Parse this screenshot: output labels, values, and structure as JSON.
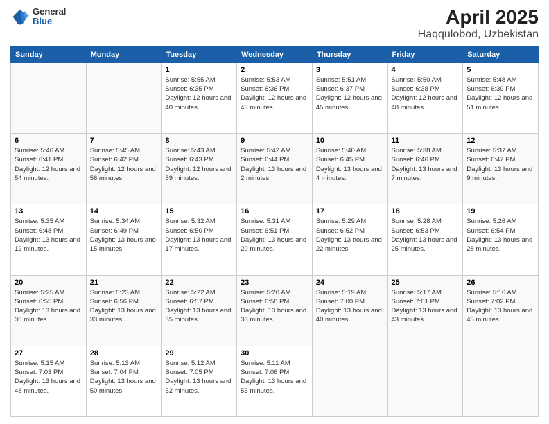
{
  "logo": {
    "general": "General",
    "blue": "Blue"
  },
  "title": "April 2025",
  "subtitle": "Haqqulobod, Uzbekistan",
  "days_of_week": [
    "Sunday",
    "Monday",
    "Tuesday",
    "Wednesday",
    "Thursday",
    "Friday",
    "Saturday"
  ],
  "weeks": [
    [
      {
        "day": "",
        "info": ""
      },
      {
        "day": "",
        "info": ""
      },
      {
        "day": "1",
        "info": "Sunrise: 5:55 AM\nSunset: 6:35 PM\nDaylight: 12 hours\nand 40 minutes."
      },
      {
        "day": "2",
        "info": "Sunrise: 5:53 AM\nSunset: 6:36 PM\nDaylight: 12 hours\nand 43 minutes."
      },
      {
        "day": "3",
        "info": "Sunrise: 5:51 AM\nSunset: 6:37 PM\nDaylight: 12 hours\nand 45 minutes."
      },
      {
        "day": "4",
        "info": "Sunrise: 5:50 AM\nSunset: 6:38 PM\nDaylight: 12 hours\nand 48 minutes."
      },
      {
        "day": "5",
        "info": "Sunrise: 5:48 AM\nSunset: 6:39 PM\nDaylight: 12 hours\nand 51 minutes."
      }
    ],
    [
      {
        "day": "6",
        "info": "Sunrise: 5:46 AM\nSunset: 6:41 PM\nDaylight: 12 hours\nand 54 minutes."
      },
      {
        "day": "7",
        "info": "Sunrise: 5:45 AM\nSunset: 6:42 PM\nDaylight: 12 hours\nand 56 minutes."
      },
      {
        "day": "8",
        "info": "Sunrise: 5:43 AM\nSunset: 6:43 PM\nDaylight: 12 hours\nand 59 minutes."
      },
      {
        "day": "9",
        "info": "Sunrise: 5:42 AM\nSunset: 6:44 PM\nDaylight: 13 hours\nand 2 minutes."
      },
      {
        "day": "10",
        "info": "Sunrise: 5:40 AM\nSunset: 6:45 PM\nDaylight: 13 hours\nand 4 minutes."
      },
      {
        "day": "11",
        "info": "Sunrise: 5:38 AM\nSunset: 6:46 PM\nDaylight: 13 hours\nand 7 minutes."
      },
      {
        "day": "12",
        "info": "Sunrise: 5:37 AM\nSunset: 6:47 PM\nDaylight: 13 hours\nand 9 minutes."
      }
    ],
    [
      {
        "day": "13",
        "info": "Sunrise: 5:35 AM\nSunset: 6:48 PM\nDaylight: 13 hours\nand 12 minutes."
      },
      {
        "day": "14",
        "info": "Sunrise: 5:34 AM\nSunset: 6:49 PM\nDaylight: 13 hours\nand 15 minutes."
      },
      {
        "day": "15",
        "info": "Sunrise: 5:32 AM\nSunset: 6:50 PM\nDaylight: 13 hours\nand 17 minutes."
      },
      {
        "day": "16",
        "info": "Sunrise: 5:31 AM\nSunset: 6:51 PM\nDaylight: 13 hours\nand 20 minutes."
      },
      {
        "day": "17",
        "info": "Sunrise: 5:29 AM\nSunset: 6:52 PM\nDaylight: 13 hours\nand 22 minutes."
      },
      {
        "day": "18",
        "info": "Sunrise: 5:28 AM\nSunset: 6:53 PM\nDaylight: 13 hours\nand 25 minutes."
      },
      {
        "day": "19",
        "info": "Sunrise: 5:26 AM\nSunset: 6:54 PM\nDaylight: 13 hours\nand 28 minutes."
      }
    ],
    [
      {
        "day": "20",
        "info": "Sunrise: 5:25 AM\nSunset: 6:55 PM\nDaylight: 13 hours\nand 30 minutes."
      },
      {
        "day": "21",
        "info": "Sunrise: 5:23 AM\nSunset: 6:56 PM\nDaylight: 13 hours\nand 33 minutes."
      },
      {
        "day": "22",
        "info": "Sunrise: 5:22 AM\nSunset: 6:57 PM\nDaylight: 13 hours\nand 35 minutes."
      },
      {
        "day": "23",
        "info": "Sunrise: 5:20 AM\nSunset: 6:58 PM\nDaylight: 13 hours\nand 38 minutes."
      },
      {
        "day": "24",
        "info": "Sunrise: 5:19 AM\nSunset: 7:00 PM\nDaylight: 13 hours\nand 40 minutes."
      },
      {
        "day": "25",
        "info": "Sunrise: 5:17 AM\nSunset: 7:01 PM\nDaylight: 13 hours\nand 43 minutes."
      },
      {
        "day": "26",
        "info": "Sunrise: 5:16 AM\nSunset: 7:02 PM\nDaylight: 13 hours\nand 45 minutes."
      }
    ],
    [
      {
        "day": "27",
        "info": "Sunrise: 5:15 AM\nSunset: 7:03 PM\nDaylight: 13 hours\nand 48 minutes."
      },
      {
        "day": "28",
        "info": "Sunrise: 5:13 AM\nSunset: 7:04 PM\nDaylight: 13 hours\nand 50 minutes."
      },
      {
        "day": "29",
        "info": "Sunrise: 5:12 AM\nSunset: 7:05 PM\nDaylight: 13 hours\nand 52 minutes."
      },
      {
        "day": "30",
        "info": "Sunrise: 5:11 AM\nSunset: 7:06 PM\nDaylight: 13 hours\nand 55 minutes."
      },
      {
        "day": "",
        "info": ""
      },
      {
        "day": "",
        "info": ""
      },
      {
        "day": "",
        "info": ""
      }
    ]
  ]
}
